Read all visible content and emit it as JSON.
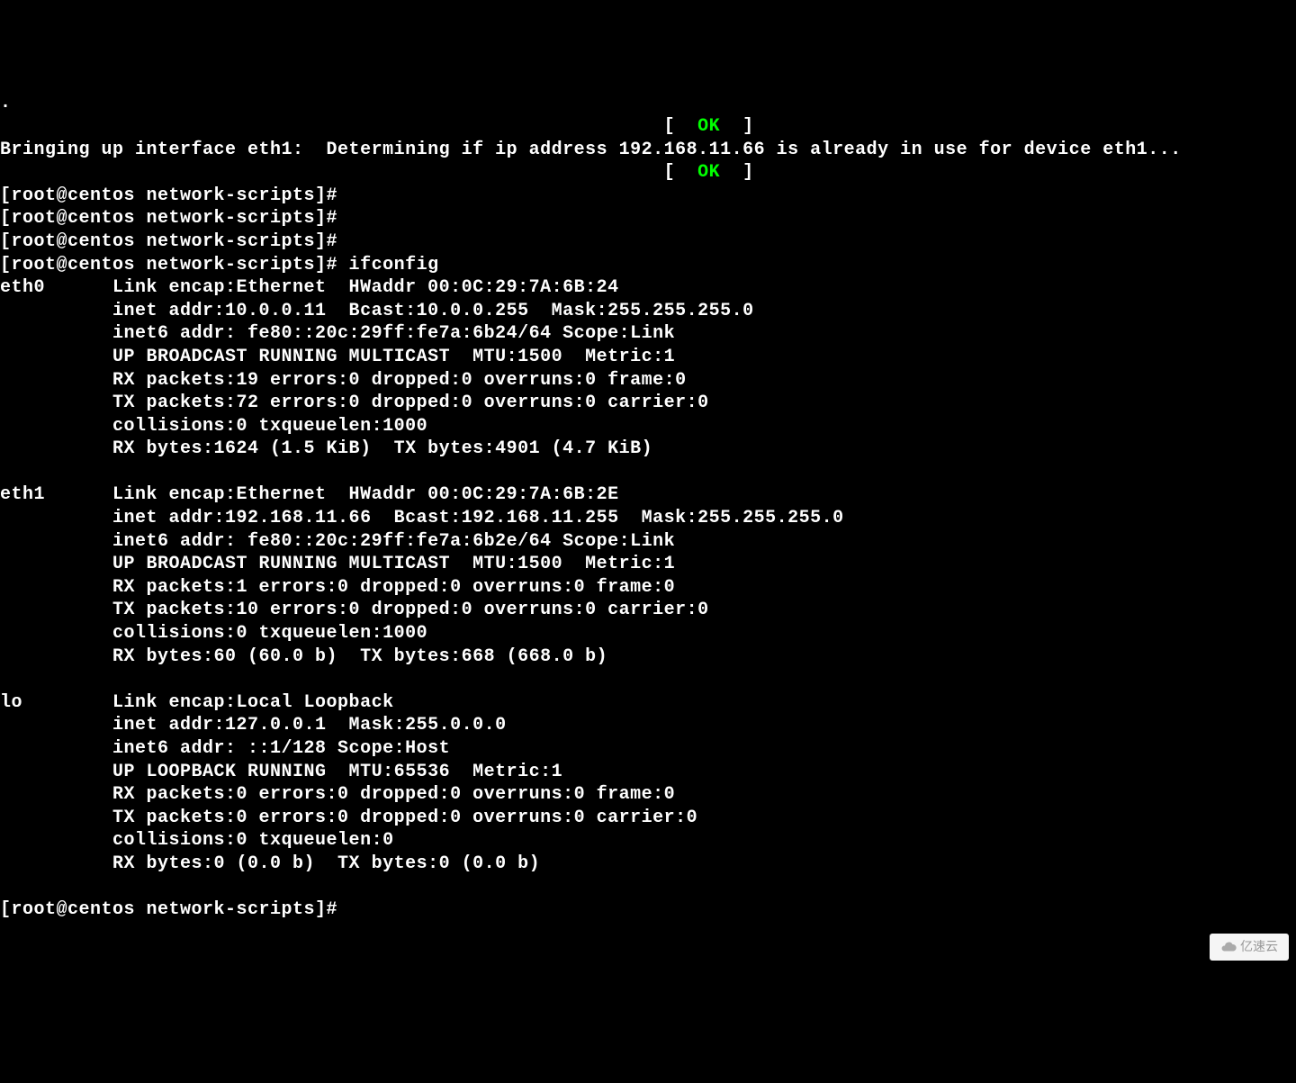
{
  "lines": {
    "l0": ".",
    "l1_pre": "                                                           [  ",
    "l1_ok": "OK",
    "l1_post": "  ]",
    "l2": "Bringing up interface eth1:  Determining if ip address 192.168.11.66 is already in use for device eth1...",
    "l3_pre": "                                                           [  ",
    "l3_ok": "OK",
    "l3_post": "  ]",
    "p1": "[root@centos network-scripts]#",
    "p2": "[root@centos network-scripts]#",
    "p3": "[root@centos network-scripts]#",
    "p4": "[root@centos network-scripts]# ifconfig",
    "e0_1": "eth0      Link encap:Ethernet  HWaddr 00:0C:29:7A:6B:24",
    "e0_2": "          inet addr:10.0.0.11  Bcast:10.0.0.255  Mask:255.255.255.0",
    "e0_3": "          inet6 addr: fe80::20c:29ff:fe7a:6b24/64 Scope:Link",
    "e0_4": "          UP BROADCAST RUNNING MULTICAST  MTU:1500  Metric:1",
    "e0_5": "          RX packets:19 errors:0 dropped:0 overruns:0 frame:0",
    "e0_6": "          TX packets:72 errors:0 dropped:0 overruns:0 carrier:0",
    "e0_7": "          collisions:0 txqueuelen:1000",
    "e0_8": "          RX bytes:1624 (1.5 KiB)  TX bytes:4901 (4.7 KiB)",
    "blank1": "",
    "e1_1": "eth1      Link encap:Ethernet  HWaddr 00:0C:29:7A:6B:2E",
    "e1_2": "          inet addr:192.168.11.66  Bcast:192.168.11.255  Mask:255.255.255.0",
    "e1_3": "          inet6 addr: fe80::20c:29ff:fe7a:6b2e/64 Scope:Link",
    "e1_4": "          UP BROADCAST RUNNING MULTICAST  MTU:1500  Metric:1",
    "e1_5": "          RX packets:1 errors:0 dropped:0 overruns:0 frame:0",
    "e1_6": "          TX packets:10 errors:0 dropped:0 overruns:0 carrier:0",
    "e1_7": "          collisions:0 txqueuelen:1000",
    "e1_8": "          RX bytes:60 (60.0 b)  TX bytes:668 (668.0 b)",
    "blank2": "",
    "lo_1": "lo        Link encap:Local Loopback",
    "lo_2": "          inet addr:127.0.0.1  Mask:255.0.0.0",
    "lo_3": "          inet6 addr: ::1/128 Scope:Host",
    "lo_4": "          UP LOOPBACK RUNNING  MTU:65536  Metric:1",
    "lo_5": "          RX packets:0 errors:0 dropped:0 overruns:0 frame:0",
    "lo_6": "          TX packets:0 errors:0 dropped:0 overruns:0 carrier:0",
    "lo_7": "          collisions:0 txqueuelen:0",
    "lo_8": "          RX bytes:0 (0.0 b)  TX bytes:0 (0.0 b)",
    "blank3": "",
    "p5": "[root@centos network-scripts]#"
  },
  "watermark": "亿速云"
}
